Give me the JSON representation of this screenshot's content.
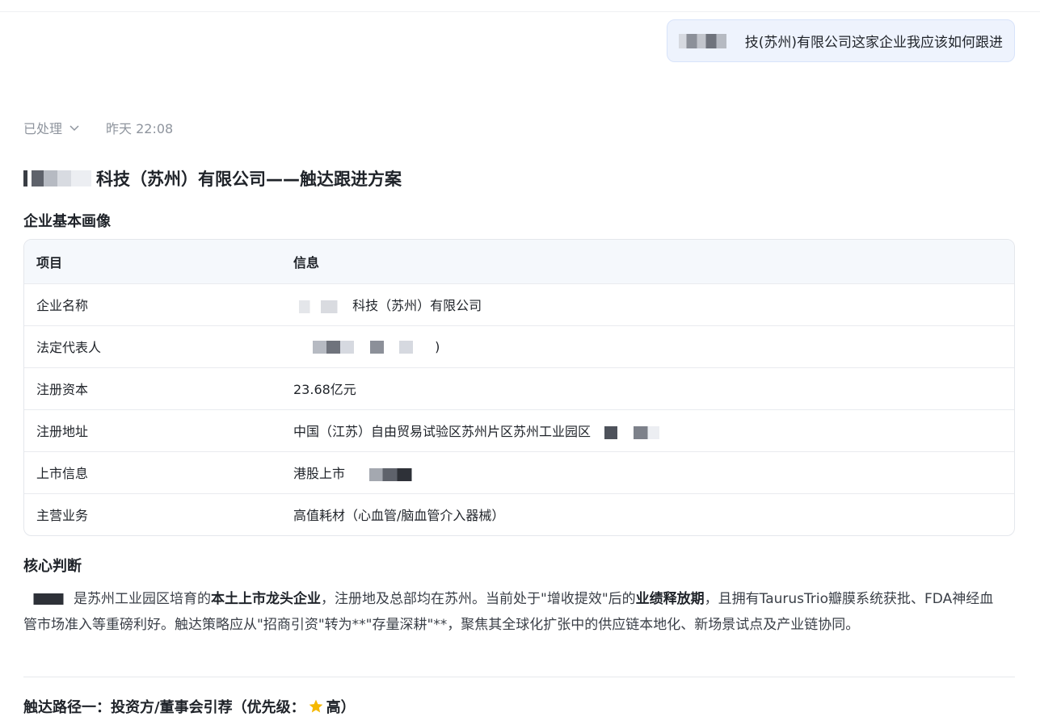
{
  "user_message": {
    "text": "技(苏州)有限公司这家企业我应该如何跟进"
  },
  "meta": {
    "status": "已处理",
    "time": "昨天 22:08"
  },
  "title": "科技（苏州）有限公司——触达跟进方案",
  "sections": {
    "profile_heading": "企业基本画像",
    "judgment_heading": "核心判断"
  },
  "table": {
    "headers": [
      "项目",
      "信息"
    ],
    "rows": [
      {
        "label": "企业名称",
        "value": "科技（苏州）有限公司"
      },
      {
        "label": "法定代表人",
        "value": ")"
      },
      {
        "label": "注册资本",
        "value": "23.68亿元"
      },
      {
        "label": "注册地址",
        "value": "中国（江苏）自由贸易试验区苏州片区苏州工业园区"
      },
      {
        "label": "上市信息",
        "value": "港股上市"
      },
      {
        "label": "主营业务",
        "value": "高值耗材（心血管/脑血管介入器械）"
      }
    ]
  },
  "judgment": {
    "p1": "是苏州工业园区培育的",
    "b1": "本土上市龙头企业",
    "p2": "，注册地及总部均在苏州。当前处于\"增收提效\"后的",
    "b2": "业绩释放期",
    "p3": "，且拥有TaurusTrio瓣膜系统获批、FDA神经血管市场准入等重磅利好。触达策略应从\"招商引资\"转为**\"存量深耕\"**，聚焦其全球化扩张中的供应链本地化、新场景试点及产业链协同。"
  },
  "route1": {
    "prefix": "触达路径一：投资方/董事会引荐（优先级：",
    "level": "高",
    "suffix": "）",
    "icon": "star-icon"
  },
  "colors": {
    "accent_bg": "#eef3fd",
    "star": "#f5b800"
  }
}
